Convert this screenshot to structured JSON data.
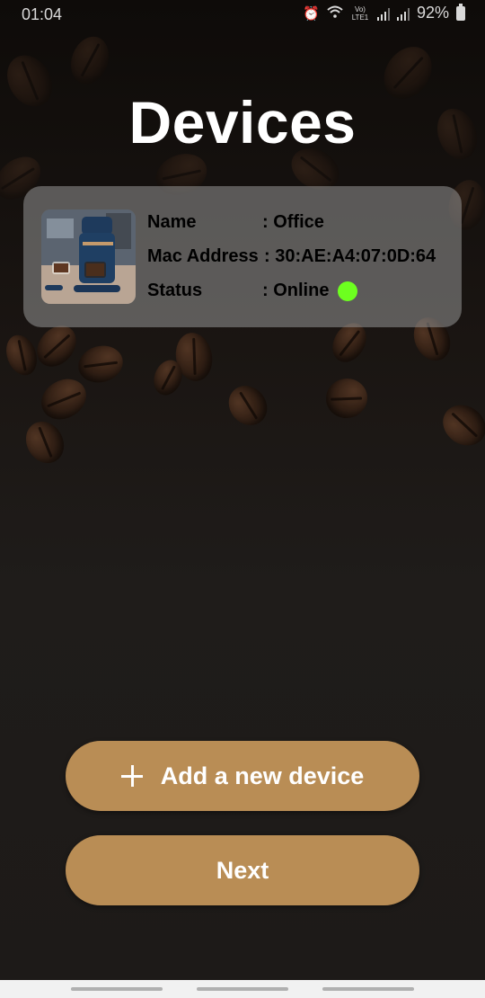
{
  "status_bar": {
    "time": "01:04",
    "network_label": "Vo) LTE1",
    "battery": "92%"
  },
  "title": "Devices",
  "device": {
    "name_label": "Name",
    "name_value": ": Office",
    "mac_label": "Mac Address",
    "mac_value": ": 30:AE:A4:07:0D:64",
    "status_label": "Status",
    "status_value": ": Online",
    "status_color": "#6dff1f",
    "image_icon": "coffee-machine"
  },
  "buttons": {
    "add_device": "Add a new device",
    "next": "Next"
  },
  "colors": {
    "button": "#b98d55",
    "card": "#969696"
  }
}
